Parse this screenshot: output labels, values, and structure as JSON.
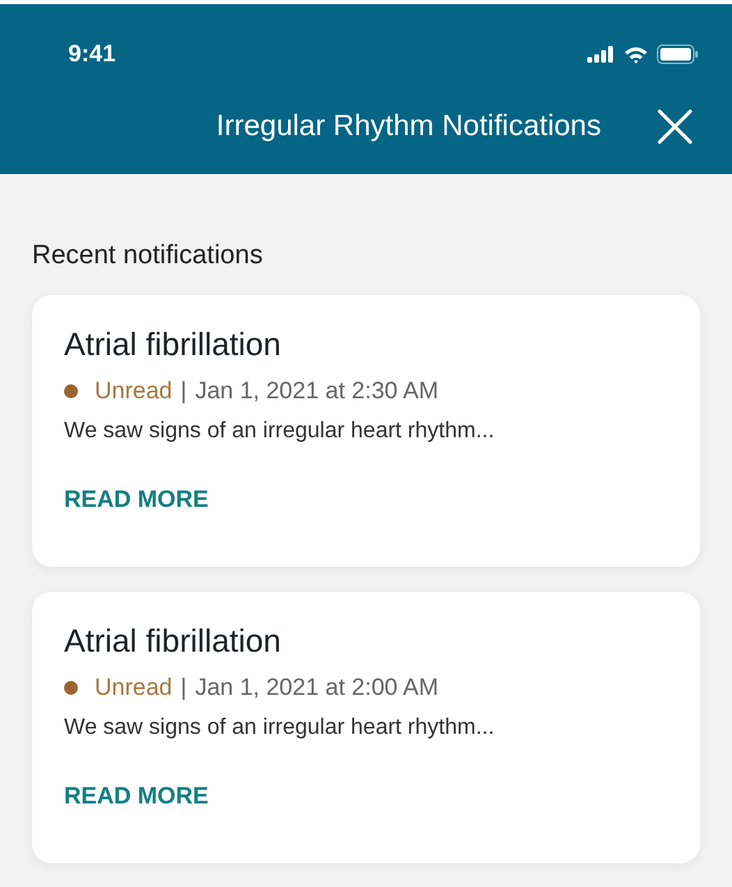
{
  "status_bar": {
    "time": "9:41"
  },
  "header": {
    "title": "Irregular Rhythm Notifications"
  },
  "section_title": "Recent notifications",
  "notifications": [
    {
      "title": "Atrial fibrillation",
      "unread": true,
      "status": "Unread",
      "separator": "|",
      "timestamp": "Jan 1, 2021 at 2:30 AM",
      "message": "We saw signs of an irregular heart rhythm...",
      "action": "READ MORE"
    },
    {
      "title": "Atrial fibrillation",
      "unread": true,
      "status": "Unread",
      "separator": "|",
      "timestamp": "Jan 1, 2021 at 2:00 AM",
      "message": "We saw signs of an irregular heart rhythm...",
      "action": "READ MORE"
    }
  ]
}
